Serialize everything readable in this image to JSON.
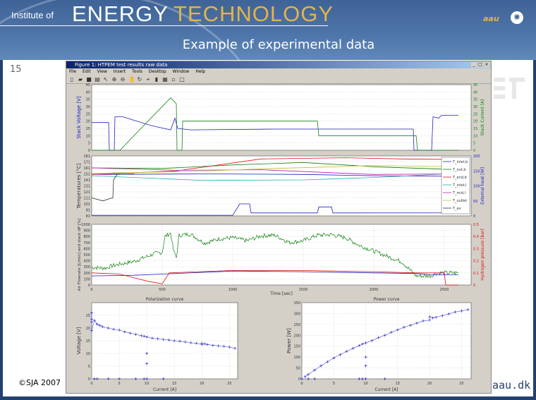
{
  "header": {
    "institute": "Institute of",
    "energy": "ENERGY",
    "technology": "TECHNOLOGY",
    "aau_mark": "aau",
    "slide_title": "Example of experimental data"
  },
  "slide_number": "15",
  "footer": {
    "copyright": "©SJA 2007",
    "site": "aau.dk"
  },
  "window": {
    "title": "Figure 1: HTPEM test results raw data",
    "menu": [
      "File",
      "Edit",
      "View",
      "Insert",
      "Tools",
      "Desktop",
      "Window",
      "Help"
    ],
    "toolbar_icons": [
      "new-icon",
      "open-icon",
      "save-icon",
      "print-icon",
      "pointer-icon",
      "zoom-in-icon",
      "zoom-out-icon",
      "pan-icon",
      "rotate-icon",
      "datacursor-icon",
      "colorbar-icon",
      "legend-icon",
      "hide-icon",
      "show-icon"
    ]
  },
  "colors": {
    "blue": "#2020c0",
    "green": "#108010",
    "red": "#e01010",
    "bg": "#d4d0c8"
  },
  "chart_data": [
    {
      "type": "line",
      "id": "voltage",
      "ylabel": "Stack Voltage [V]",
      "y2label": "Stack Current [A]",
      "xlim": [
        0,
        2690
      ],
      "ylim": [
        0,
        45
      ],
      "y2lim": [
        0,
        45
      ],
      "yticks": [
        0,
        5,
        10,
        15,
        20,
        25,
        30,
        35,
        40,
        45
      ],
      "series": [
        {
          "name": "Stack Voltage",
          "axis": "left",
          "color": "#2020c0",
          "points": [
            [
              0,
              19
            ],
            [
              120,
              19
            ],
            [
              125,
              0
            ],
            [
              160,
              0
            ],
            [
              165,
              23
            ],
            [
              220,
              23
            ],
            [
              420,
              17
            ],
            [
              560,
              14
            ],
            [
              590,
              22
            ],
            [
              610,
              15
            ],
            [
              700,
              14
            ],
            [
              1300,
              14.5
            ],
            [
              2280,
              14.5
            ],
            [
              2285,
              0
            ],
            [
              2410,
              0
            ],
            [
              2420,
              23
            ],
            [
              2460,
              22
            ],
            [
              2480,
              24
            ],
            [
              2600,
              24
            ]
          ]
        },
        {
          "name": "Stack Current",
          "axis": "right",
          "color": "#108010",
          "points": [
            [
              0,
              0
            ],
            [
              200,
              0
            ],
            [
              560,
              36
            ],
            [
              600,
              32
            ],
            [
              605,
              0
            ],
            [
              640,
              0
            ],
            [
              645,
              20
            ],
            [
              1600,
              20
            ],
            [
              1610,
              10
            ],
            [
              2300,
              10
            ],
            [
              2310,
              0
            ],
            [
              2600,
              0
            ]
          ]
        }
      ]
    },
    {
      "type": "line",
      "id": "temperature",
      "ylabel": "Temperatures [°C]",
      "y2label": "External heat [W]",
      "xlim": [
        0,
        2690
      ],
      "ylim": [
        81,
        181
      ],
      "y2lim": [
        0,
        200
      ],
      "yticks": [
        81,
        91,
        101,
        111,
        121,
        131,
        141,
        151,
        161,
        171,
        181
      ],
      "y2ticks": [
        0,
        50,
        100,
        150,
        200
      ],
      "legend": [
        "T_inlet,b",
        "T_out,b",
        "T_end,b",
        "T_inlet,l",
        "T_mid,l",
        "T_outlet",
        "T_ex"
      ],
      "legend_position": "right",
      "series": [
        {
          "name": "T_inlet,b",
          "color": "#2020c0",
          "points": [
            [
              0,
              150
            ],
            [
              800,
              151
            ],
            [
              1500,
              150
            ],
            [
              2000,
              148
            ],
            [
              2600,
              147
            ]
          ]
        },
        {
          "name": "T_out,b",
          "color": "#108010",
          "points": [
            [
              0,
              161
            ],
            [
              500,
              160
            ],
            [
              1000,
              166
            ],
            [
              1500,
              170
            ],
            [
              2000,
              163
            ],
            [
              2600,
              158
            ]
          ]
        },
        {
          "name": "T_end,b",
          "color": "#e01010",
          "points": [
            [
              0,
              150
            ],
            [
              600,
              156
            ],
            [
              1200,
              176
            ],
            [
              1800,
              178
            ],
            [
              2200,
              176
            ],
            [
              2600,
              175
            ]
          ]
        },
        {
          "name": "T_inlet,l",
          "color": "#20b0b0",
          "points": [
            [
              0,
              148
            ],
            [
              400,
              144
            ],
            [
              800,
              140
            ],
            [
              1500,
              141
            ],
            [
              2000,
              145
            ],
            [
              2600,
              152
            ]
          ]
        },
        {
          "name": "T_mid,l",
          "color": "#b020b0",
          "points": [
            [
              0,
              161
            ],
            [
              600,
              157
            ],
            [
              1200,
              158
            ],
            [
              2000,
              150
            ],
            [
              2600,
              151
            ]
          ]
        },
        {
          "name": "T_outlet",
          "color": "#c0c030",
          "points": [
            [
              0,
              152
            ],
            [
              700,
              155
            ],
            [
              1300,
              160
            ],
            [
              2000,
              165
            ],
            [
              2600,
              163
            ]
          ]
        },
        {
          "name": "T_ex",
          "color": "#303030",
          "points": [
            [
              0,
              111
            ],
            [
              80,
              106
            ],
            [
              130,
              110
            ],
            [
              150,
              111
            ],
            [
              155,
              141
            ],
            [
              180,
              150
            ],
            [
              300,
              151
            ]
          ]
        },
        {
          "name": "External heat",
          "color": "#2020c0",
          "axis": "right",
          "points": [
            [
              0,
              2
            ],
            [
              1000,
              2
            ],
            [
              1010,
              10
            ],
            [
              1050,
              40
            ],
            [
              1120,
              40
            ],
            [
              1130,
              10
            ],
            [
              1600,
              10
            ],
            [
              1610,
              30
            ],
            [
              1700,
              30
            ],
            [
              1710,
              10
            ],
            [
              2600,
              10
            ]
          ]
        }
      ]
    },
    {
      "type": "line",
      "id": "flow",
      "ylabel": "Air Flowrate [L/min] and stack dP [%]",
      "y2label": "Hydrogen pressure [bar]",
      "xlabel": "Time [sec]",
      "xlim": [
        0,
        2690
      ],
      "ylim": [
        0,
        1000
      ],
      "y2lim": [
        0,
        0.5
      ],
      "yticks": [
        0,
        100,
        200,
        300,
        400,
        500,
        600,
        700,
        800,
        900,
        1000
      ],
      "y2ticks": [
        0,
        0.1,
        0.2,
        0.3,
        0.4,
        0.5
      ],
      "xticks": [
        0,
        500,
        1000,
        1500,
        2000,
        2500
      ],
      "series": [
        {
          "name": "Air flowrate",
          "color": "#108010",
          "points": [
            [
              0,
              290
            ],
            [
              100,
              280
            ],
            [
              150,
              320
            ],
            [
              300,
              390
            ],
            [
              450,
              520
            ],
            [
              500,
              540
            ],
            [
              520,
              800
            ],
            [
              560,
              860
            ],
            [
              580,
              570
            ],
            [
              600,
              450
            ],
            [
              620,
              820
            ],
            [
              700,
              840
            ],
            [
              800,
              690
            ],
            [
              900,
              760
            ],
            [
              1000,
              780
            ],
            [
              1100,
              730
            ],
            [
              1200,
              810
            ],
            [
              1300,
              820
            ],
            [
              1400,
              700
            ],
            [
              1500,
              730
            ],
            [
              1600,
              820
            ],
            [
              1700,
              830
            ],
            [
              1800,
              780
            ],
            [
              1900,
              650
            ],
            [
              2000,
              560
            ],
            [
              2200,
              380
            ],
            [
              2300,
              150
            ],
            [
              2400,
              150
            ],
            [
              2450,
              200
            ],
            [
              2600,
              200
            ]
          ]
        },
        {
          "name": "Stack dP",
          "color": "#2020c0",
          "points": [
            [
              0,
              150
            ],
            [
              300,
              160
            ],
            [
              500,
              180
            ],
            [
              1000,
              230
            ],
            [
              1500,
              220
            ],
            [
              2000,
              200
            ],
            [
              2300,
              190
            ],
            [
              2400,
              170
            ],
            [
              2600,
              170
            ]
          ]
        },
        {
          "name": "Hydrogen pressure",
          "axis": "right",
          "color": "#e01010",
          "points": [
            [
              0,
              0.1
            ],
            [
              200,
              0.09
            ],
            [
              300,
              0.06
            ],
            [
              400,
              0.03
            ],
            [
              500,
              0.01
            ],
            [
              550,
              0.1
            ],
            [
              1000,
              0.12
            ],
            [
              1500,
              0.12
            ],
            [
              2000,
              0.11
            ],
            [
              2300,
              0.1
            ],
            [
              2500,
              0.1
            ],
            [
              2510,
              0
            ],
            [
              2600,
              0
            ]
          ]
        }
      ]
    },
    {
      "type": "scatter",
      "id": "polarization",
      "title": "Polarization curve",
      "xlabel": "Current [A]",
      "ylabel": "Voltage [V]",
      "xlim": [
        0,
        26.5
      ],
      "ylim": [
        0,
        30
      ],
      "xticks": [
        0,
        5,
        10,
        15,
        20,
        25
      ],
      "yticks": [
        0,
        5,
        10,
        15,
        20,
        25
      ],
      "x": [
        0,
        0,
        0,
        0,
        0.5,
        1,
        1.5,
        2,
        3,
        4,
        5,
        6,
        7,
        8,
        9,
        9.5,
        10,
        10,
        10,
        11,
        12,
        13,
        14,
        15,
        16,
        17,
        18,
        19,
        20,
        20,
        20.5,
        21,
        22,
        23,
        24,
        25,
        26,
        0.5,
        1,
        3,
        5,
        8,
        9.5,
        10,
        13
      ],
      "y": [
        26,
        23.5,
        22.5,
        19,
        23,
        21.5,
        21,
        20.5,
        20,
        19.5,
        19.2,
        18.5,
        18,
        17.5,
        17,
        16.8,
        16.5,
        10,
        6,
        16,
        15.8,
        15.5,
        15.3,
        15,
        14.8,
        14.5,
        14.2,
        14,
        13.5,
        14,
        13.8,
        13.5,
        13.2,
        13,
        12.8,
        12.5,
        12,
        0,
        0,
        0,
        0,
        0,
        0,
        0,
        0
      ]
    },
    {
      "type": "scatter",
      "id": "power",
      "title": "Power curve",
      "xlabel": "Current [A]",
      "ylabel": "Power [W]",
      "xlim": [
        0,
        26.5
      ],
      "ylim": [
        0,
        350
      ],
      "xticks": [
        0,
        5,
        10,
        15,
        20,
        25
      ],
      "yticks": [
        0,
        50,
        100,
        150,
        200,
        250,
        300,
        350
      ],
      "x": [
        0,
        0.5,
        1,
        2,
        3,
        4,
        5,
        6,
        7,
        8,
        9,
        9.5,
        10,
        10,
        10,
        11,
        12,
        13,
        14,
        15,
        16,
        17,
        18,
        19,
        20,
        20,
        20.5,
        21,
        22,
        23,
        24,
        25,
        26,
        1,
        2,
        9,
        9.5,
        10,
        13
      ],
      "y": [
        0,
        10,
        20,
        40,
        60,
        78,
        96,
        111,
        126,
        140,
        153,
        160,
        165,
        100,
        60,
        176,
        189,
        200,
        214,
        225,
        237,
        246,
        256,
        266,
        270,
        285,
        280,
        283,
        290,
        298,
        307,
        312,
        318,
        0,
        0,
        0,
        0,
        0,
        0
      ]
    }
  ]
}
